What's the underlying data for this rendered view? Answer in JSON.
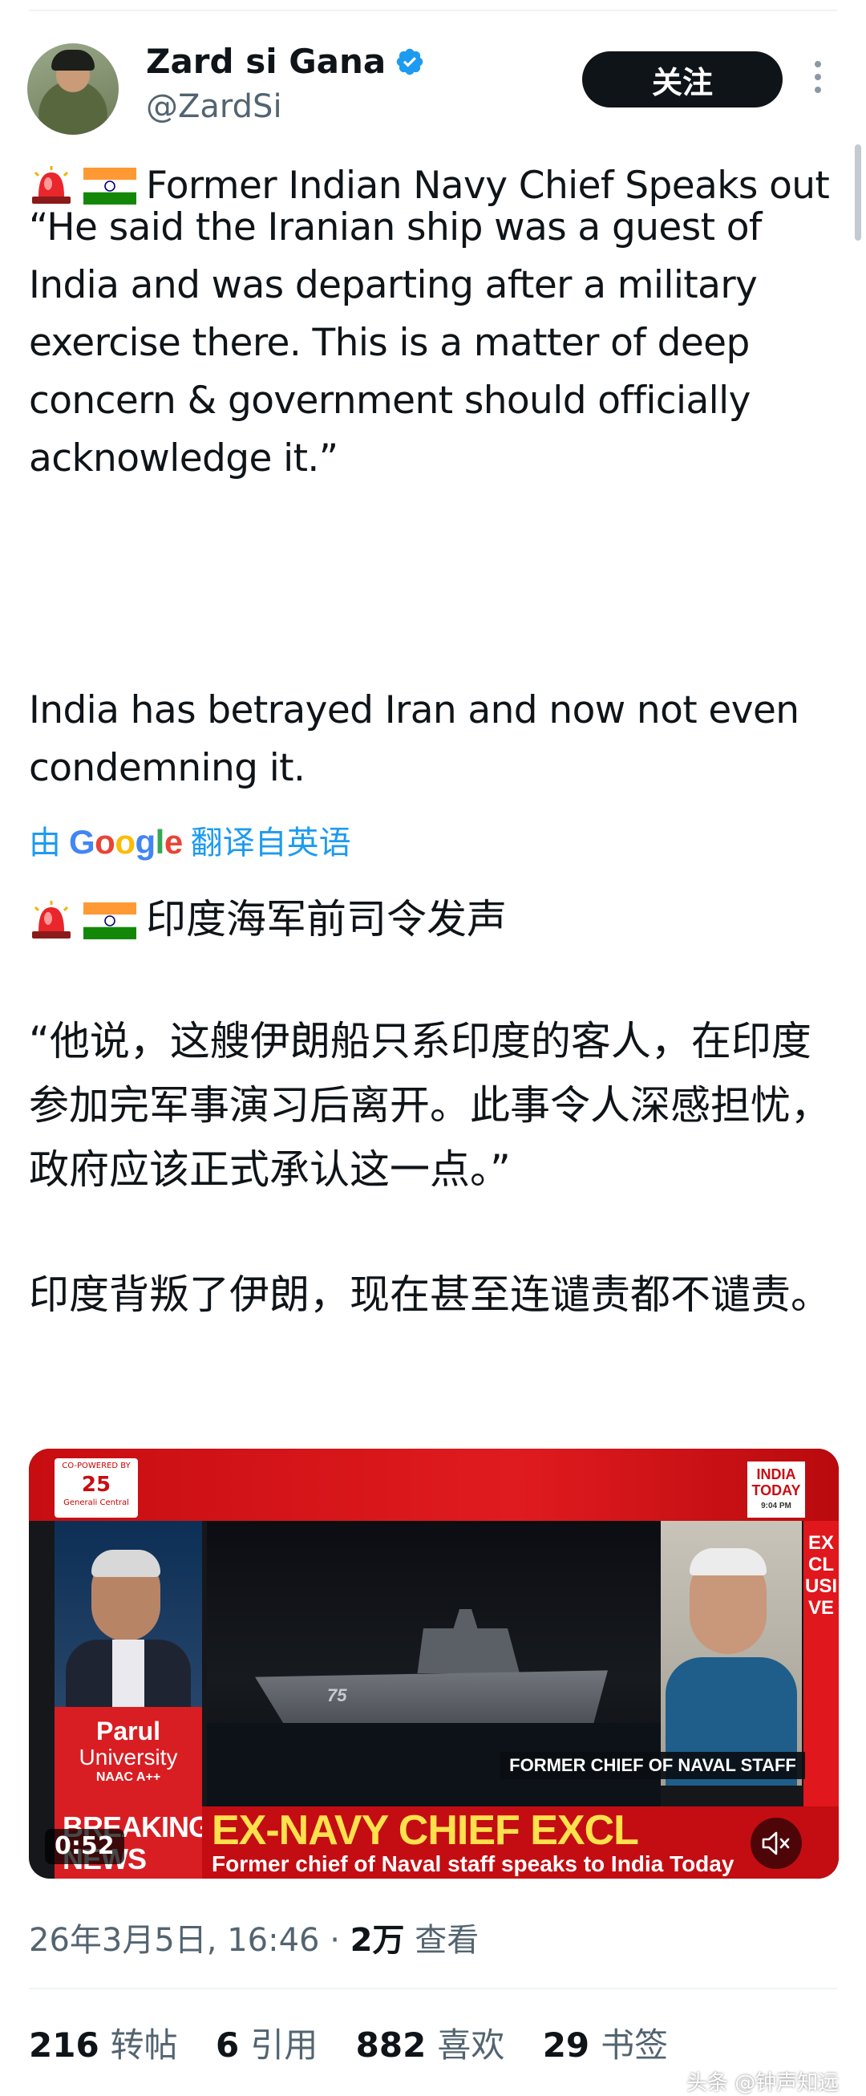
{
  "author": {
    "name": "Zard si Gana",
    "handle": "@ZardSi",
    "follow_label": "关注"
  },
  "post": {
    "headline": "Former Indian Navy Chief Speaks out",
    "quote": "“He said the Iranian ship was a guest of India and was departing after a military exercise there. This is a matter of deep concern & government should officially acknowledge it.”",
    "closing": "India has betrayed Iran and now not even condemning it."
  },
  "translation": {
    "prefix": "由",
    "provider": "Google",
    "suffix": "翻译自英语",
    "headline": "印度海军前司令发声",
    "quote": "“他说，这艘伊朗船只系印度的客人，在印度参加完军事演习后离开。此事令人深感担忧，政府应该正式承认这一点。”",
    "closing": "印度背叛了伊朗，现在甚至连谴责都不谴责。"
  },
  "video": {
    "duration": "0:52",
    "headline": "EX-NAVY CHIEF EXCL",
    "subheadline": "Former chief of Naval staff speaks to India Today",
    "breaking": "BREAKING NEWS",
    "caption": "FORMER CHIEF OF NAVAL STAFF",
    "sidebar_text": "EXCLUSIVE",
    "sponsor_top": "CO-POWERED BY",
    "sponsor_name": "Generali Central",
    "channel_logo": "INDIA TODAY",
    "channel_time": "9:04 PM",
    "ship_number": "75",
    "university_name": "Parul",
    "university_word": "University",
    "university_sub": "NAAC A++"
  },
  "meta": {
    "timestamp": "26年3月5日, 16:46",
    "separator": " · ",
    "views_count": "2万",
    "views_label": "查看"
  },
  "stats": [
    {
      "count": "216",
      "label": "转帖"
    },
    {
      "count": "6",
      "label": "引用"
    },
    {
      "count": "882",
      "label": "喜欢"
    },
    {
      "count": "29",
      "label": "书签"
    }
  ],
  "watermark": "头条 @钟声知远",
  "icons": {
    "alarm": "rotating-light-icon",
    "flag": "india-flag-icon",
    "verified": "verified-badge-icon",
    "more": "more-vertical-icon",
    "mute": "speaker-muted-icon"
  },
  "colors": {
    "accent": "#1d9bf0",
    "text": "#0f1419",
    "secondary": "#536471",
    "follow_bg": "#0f1419",
    "news_red": "#c30d12",
    "news_yellow": "#ffe14d"
  }
}
